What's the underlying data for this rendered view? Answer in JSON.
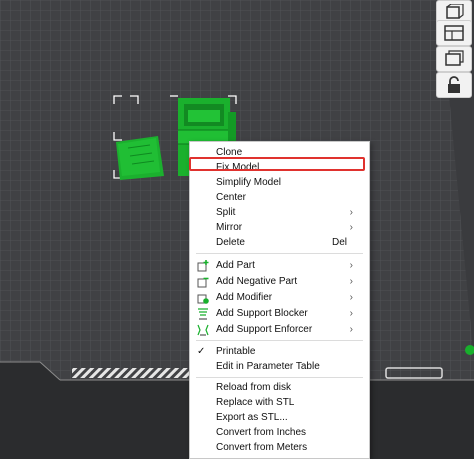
{
  "menu": {
    "items": [
      {
        "label": "Clone"
      },
      {
        "label": "Fix Model"
      },
      {
        "label": "Simplify Model"
      },
      {
        "label": "Center"
      },
      {
        "label": "Split"
      },
      {
        "label": "Mirror"
      },
      {
        "label": "Delete",
        "shortcut": "Del"
      },
      {
        "label": "Add Part"
      },
      {
        "label": "Add Negative Part"
      },
      {
        "label": "Add Modifier"
      },
      {
        "label": "Add Support Blocker"
      },
      {
        "label": "Add Support Enforcer"
      },
      {
        "label": "Printable"
      },
      {
        "label": "Edit in Parameter Table"
      },
      {
        "label": "Reload from disk"
      },
      {
        "label": "Replace with STL"
      },
      {
        "label": "Export as STL..."
      },
      {
        "label": "Convert from Inches"
      },
      {
        "label": "Convert from Meters"
      }
    ],
    "submenu_arrow": "›",
    "check_mark": "✓"
  },
  "toolbar": {
    "icons": [
      "copy-icon",
      "layout-icon",
      "stack-icon",
      "lock-icon"
    ]
  },
  "colors": {
    "model_green": "#18b02c",
    "highlight_red": "#e0322e",
    "plate_grid": "#4a4b4e"
  }
}
